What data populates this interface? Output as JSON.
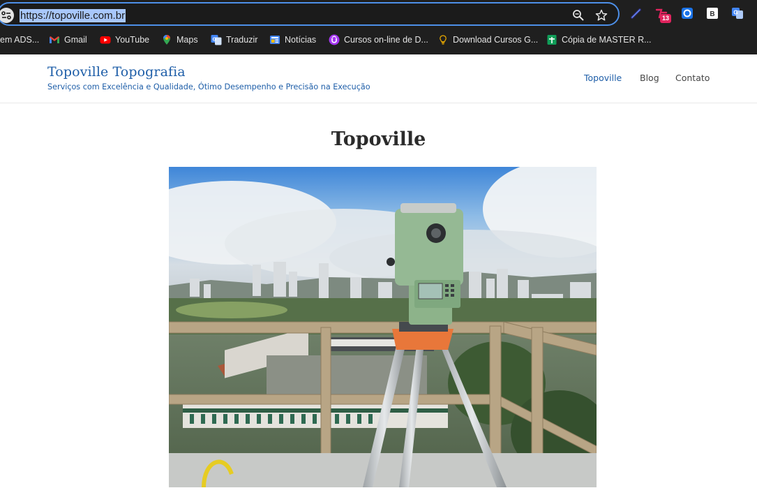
{
  "browser": {
    "url": "https://topoville.com.br",
    "extension_badge": "13",
    "bookmarks": [
      {
        "label": "em ADS...",
        "icon": "folder-icon"
      },
      {
        "label": "Gmail",
        "icon": "gmail-icon"
      },
      {
        "label": "YouTube",
        "icon": "youtube-icon"
      },
      {
        "label": "Maps",
        "icon": "maps-icon"
      },
      {
        "label": "Traduzir",
        "icon": "translate-icon"
      },
      {
        "label": "Notícias",
        "icon": "news-icon"
      },
      {
        "label": "Cursos on-line de D...",
        "icon": "udemy-icon"
      },
      {
        "label": "Download Cursos G...",
        "icon": "lightbulb-icon"
      },
      {
        "label": "Cópia de MASTER R...",
        "icon": "sheets-icon"
      }
    ]
  },
  "site": {
    "title": "Topoville Topografia",
    "tagline": "Serviços com Excelência e Qualidade, Ótimo Desempenho e Precisão na Execução",
    "nav": [
      "Topoville",
      "Blog",
      "Contato"
    ]
  },
  "main": {
    "page_title": "Topoville",
    "hero_image": "total-station-on-tripod-city-view"
  },
  "colors": {
    "chrome_bg": "#1f1f1f",
    "omnibox_border": "#4d8fe8",
    "url_highlight": "#a8c7fa",
    "brand_blue": "#1e5ea8"
  }
}
